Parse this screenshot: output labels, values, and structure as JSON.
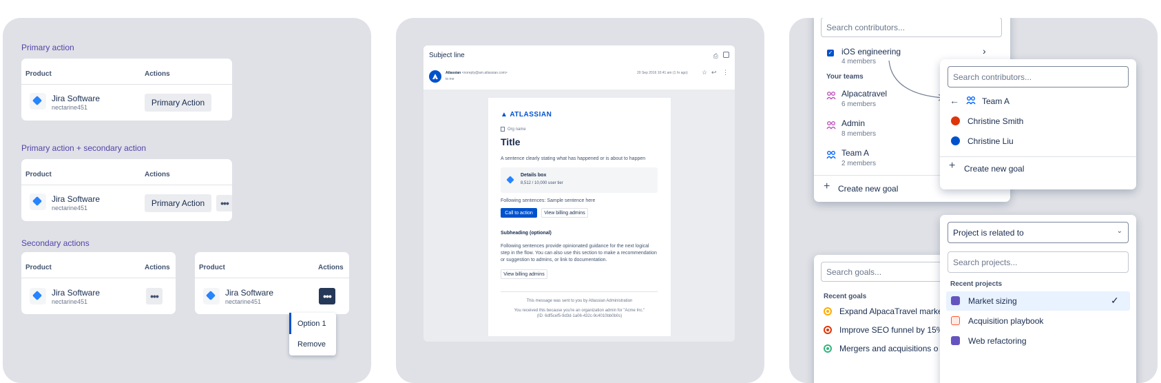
{
  "panel1": {
    "s1_title": "Primary action",
    "s2_title": "Primary action + secondary action",
    "s3_title": "Secondary actions",
    "col_product": "Product",
    "col_actions": "Actions",
    "product_name": "Jira Software",
    "product_sub": "nectarine451",
    "primary_action": "Primary Action",
    "more_glyph": "•••",
    "menu": [
      "Option 1",
      "Remove"
    ]
  },
  "panel2": {
    "subject": "Subject line",
    "sender_name": "Atlassian",
    "sender_email": "<noreply@am.atlassian.com>",
    "to_me": "to me",
    "date": "20 Sep 2016 10:41 am (1 hr ago)",
    "logo": "ATLASSIAN",
    "org_name": "Org name",
    "title": "Title",
    "intro": "A sentence clearly stating what has happened or is about to happen",
    "details_title": "Details box",
    "details_sub": "8,512 / 10,000 user tier",
    "following": "Following sentences: Sample sentence here",
    "cta": "Call to action",
    "view_admins": "View billing admins",
    "subheading": "Subheading (optional)",
    "para": "Following sentences provide opinionated guidance for the next logical step in the flow. You can also use this section to make a recommendation or suggestion to admins, or link to documentation.",
    "view_admins2": "View billing admins",
    "footer1": "This message was sent to you by Atlassian Administration",
    "footer2": "You received this because you're an organization admin for \"Acme Inc.\"",
    "footer3": "(ID: 6df5cef5-9d3d-1a06-432c-9c4010bb0b0s)"
  },
  "panel3": {
    "search_contrib": "Search contributors...",
    "ios_team": "iOS engineering",
    "ios_members": "4 members",
    "your_teams": "Your teams",
    "teams": [
      {
        "name": "Alpacatravel",
        "members": "6 members"
      },
      {
        "name": "Admin",
        "members": "8 members"
      },
      {
        "name": "Team A",
        "members": "2 members"
      }
    ],
    "create_goal": "Create new goal",
    "popup_search": "Search contributors...",
    "popup_team": "Team A",
    "people": [
      "Christine Smith",
      "Christine Liu"
    ],
    "popup_create": "Create new goal",
    "search_goals": "Search goals...",
    "recent_goals": "Recent goals",
    "goals": [
      "Expand AlpacaTravel marke",
      "Improve SEO funnel by 15%",
      "Mergers and acquisitions o"
    ],
    "relation": "Project is related to",
    "search_projects": "Search projects...",
    "recent_projects": "Recent projects",
    "projects": [
      "Market sizing",
      "Acquisition playbook",
      "Web refactoring"
    ],
    "colors": {
      "goal_yellow": "#FFAB00",
      "goal_red": "#DE350B",
      "goal_green": "#36B37E",
      "team_pink": "#C054BE",
      "team_blue": "#0065FF"
    }
  }
}
